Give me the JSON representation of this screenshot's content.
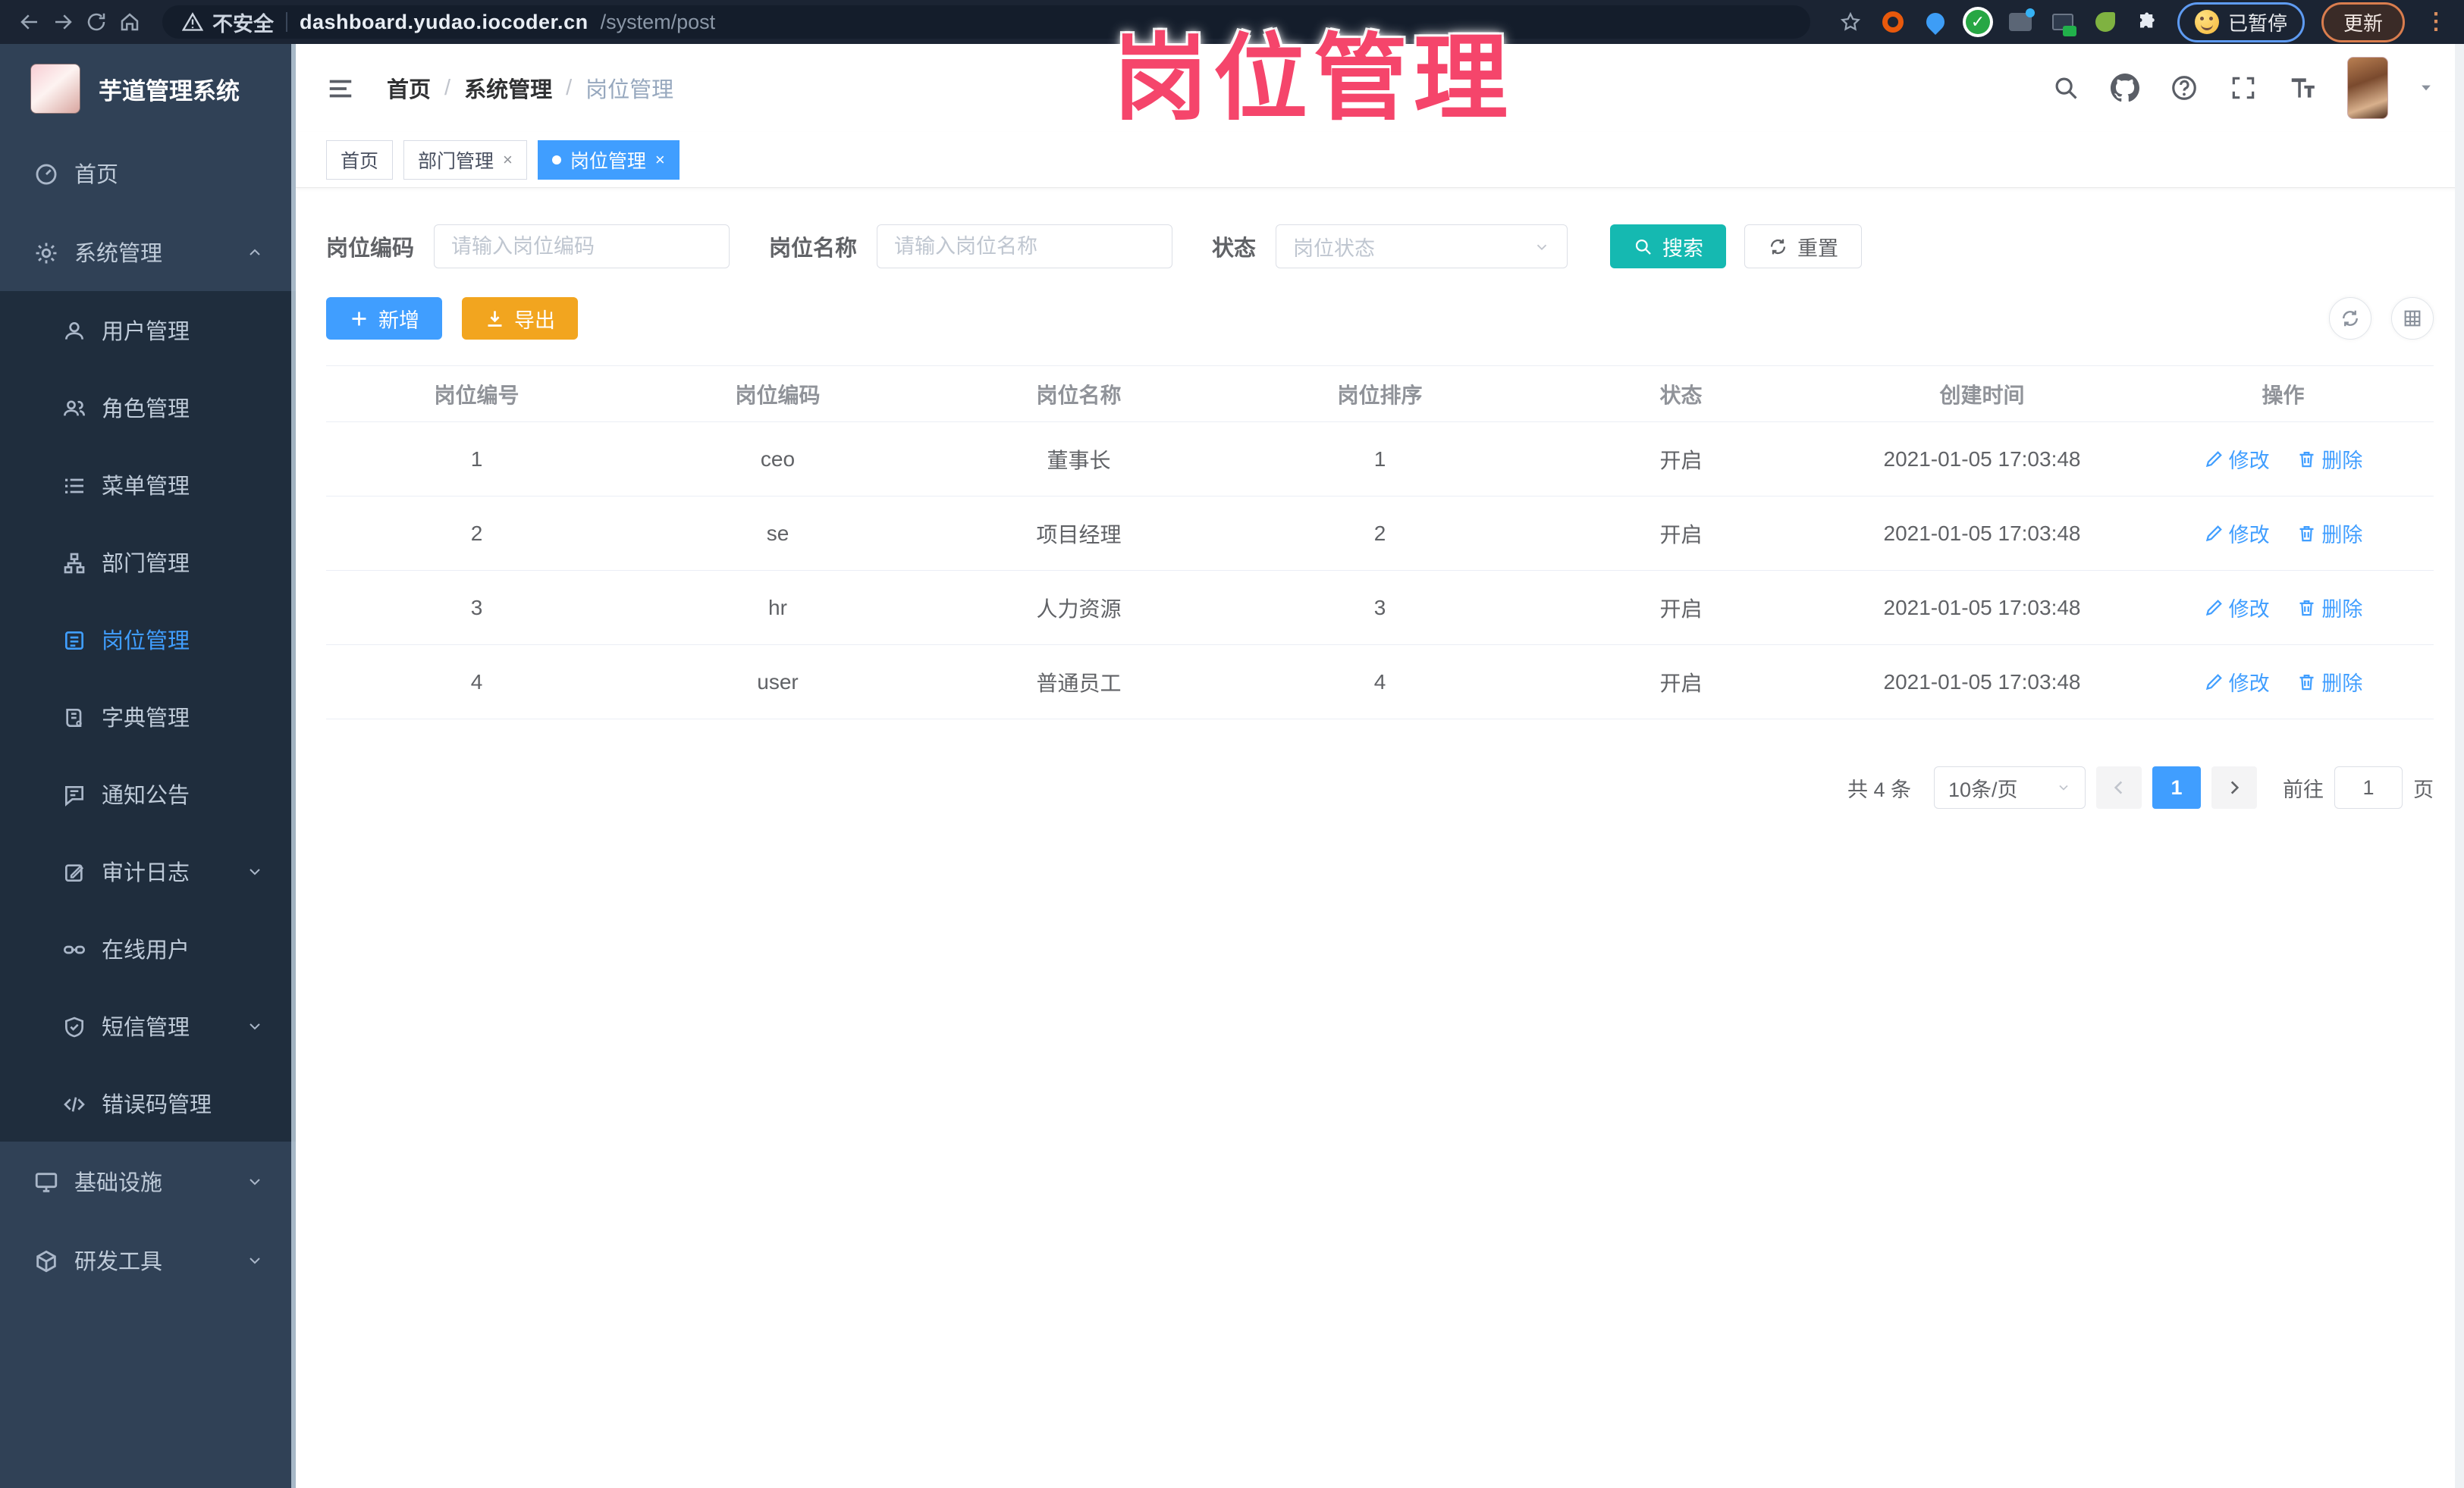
{
  "browser": {
    "security_text": "不安全",
    "url_host": "dashboard.yudao.iocoder.cn",
    "url_path": "/system/post",
    "paused_label": "已暂停",
    "update_label": "更新"
  },
  "annotation": {
    "text": "岗位管理"
  },
  "sidebar": {
    "title": "芋道管理系统",
    "home": "首页",
    "system": "系统管理",
    "submenu": [
      "用户管理",
      "角色管理",
      "菜单管理",
      "部门管理",
      "岗位管理",
      "字典管理",
      "通知公告",
      "审计日志",
      "在线用户",
      "短信管理",
      "错误码管理"
    ],
    "infra": "基础设施",
    "tools": "研发工具"
  },
  "header": {
    "breadcrumb": [
      "首页",
      "系统管理",
      "岗位管理"
    ]
  },
  "tabs": [
    {
      "label": "首页"
    },
    {
      "label": "部门管理"
    },
    {
      "label": "岗位管理"
    }
  ],
  "filters": {
    "code_label": "岗位编码",
    "code_placeholder": "请输入岗位编码",
    "name_label": "岗位名称",
    "name_placeholder": "请输入岗位名称",
    "status_label": "状态",
    "status_placeholder": "岗位状态",
    "search_label": "搜索",
    "reset_label": "重置"
  },
  "toolbar": {
    "add_label": "新增",
    "export_label": "导出"
  },
  "table": {
    "columns": [
      "岗位编号",
      "岗位编码",
      "岗位名称",
      "岗位排序",
      "状态",
      "创建时间",
      "操作"
    ],
    "actions": {
      "edit": "修改",
      "delete": "删除"
    },
    "rows": [
      {
        "id": "1",
        "code": "ceo",
        "name": "董事长",
        "sort": "1",
        "status": "开启",
        "created": "2021-01-05 17:03:48"
      },
      {
        "id": "2",
        "code": "se",
        "name": "项目经理",
        "sort": "2",
        "status": "开启",
        "created": "2021-01-05 17:03:48"
      },
      {
        "id": "3",
        "code": "hr",
        "name": "人力资源",
        "sort": "3",
        "status": "开启",
        "created": "2021-01-05 17:03:48"
      },
      {
        "id": "4",
        "code": "user",
        "name": "普通员工",
        "sort": "4",
        "status": "开启",
        "created": "2021-01-05 17:03:48"
      }
    ]
  },
  "pagination": {
    "total": "共 4 条",
    "page_size": "10条/页",
    "current": "1",
    "goto_label": "前往",
    "goto_value": "1",
    "unit_label": "页"
  },
  "colors": {
    "accent": "#409eff",
    "search_teal": "#15b9b1",
    "export_orange": "#f2a51f",
    "annotation_red": "#f5456b",
    "sidebar_bg": "#304156",
    "submenu_bg": "#1f2d3d"
  }
}
